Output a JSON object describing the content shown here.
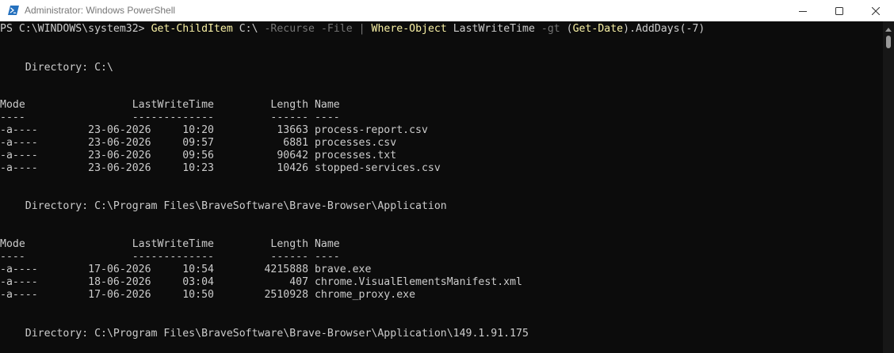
{
  "window": {
    "title": "Administrator: Windows PowerShell",
    "icon": "powershell-icon",
    "controls": [
      "minimize-icon",
      "maximize-icon",
      "close-icon"
    ]
  },
  "console": {
    "prompt": "PS C:\\WINDOWS\\system32> ",
    "command": {
      "cmdlet1": "Get-ChildItem",
      "arg1": " C:\\ ",
      "param1": "-Recurse",
      "space1": " ",
      "param2": "-File",
      "pipe": " | ",
      "cmdlet2": "Where-Object",
      "arg2": " LastWriteTime ",
      "param3": "-gt",
      "paren_open": " (",
      "cmdlet3": "Get-Date",
      "tail": ").AddDays(-7)"
    },
    "sections": [
      {
        "directory": "    Directory: C:\\",
        "header": "Mode                 LastWriteTime         Length Name",
        "separator": "----                 -------------         ------ ----",
        "rows": [
          "-a----        23-06-2026     10:20          13663 process-report.csv",
          "-a----        23-06-2026     09:57           6881 processes.csv",
          "-a----        23-06-2026     09:56          90642 processes.txt",
          "-a----        23-06-2026     10:23          10426 stopped-services.csv"
        ]
      },
      {
        "directory": "    Directory: C:\\Program Files\\BraveSoftware\\Brave-Browser\\Application",
        "header": "Mode                 LastWriteTime         Length Name",
        "separator": "----                 -------------         ------ ----",
        "rows": [
          "-a----        17-06-2026     10:54        4215888 brave.exe",
          "-a----        18-06-2026     03:04            407 chrome.VisualElementsManifest.xml",
          "-a----        17-06-2026     10:50        2510928 chrome_proxy.exe"
        ]
      },
      {
        "directory": "    Directory: C:\\Program Files\\BraveSoftware\\Brave-Browser\\Application\\149.1.91.175"
      }
    ]
  },
  "colors": {
    "background": "#0c0c0c",
    "text": "#cccccc",
    "cmdlet": "#f9f1a5",
    "parameter": "#767676"
  }
}
